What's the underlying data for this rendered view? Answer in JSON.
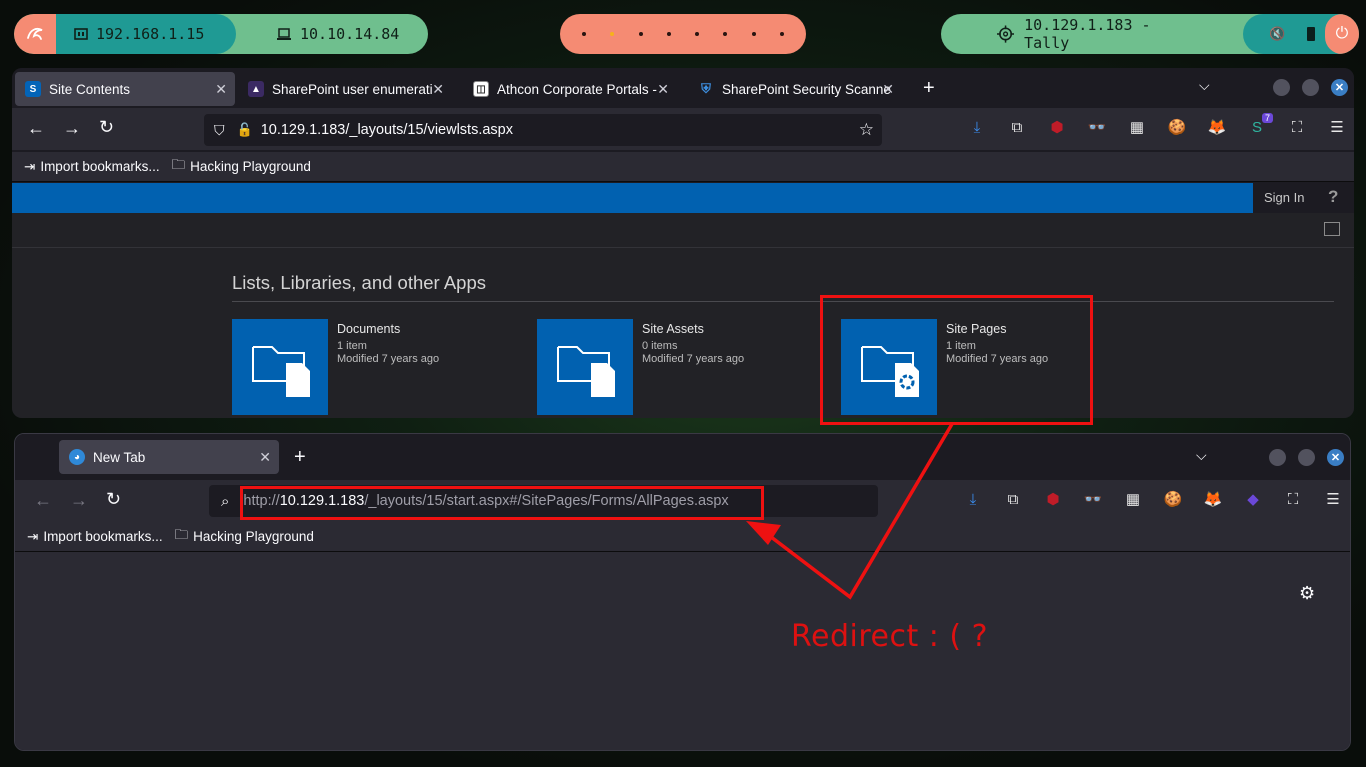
{
  "panel": {
    "local_ip": "192.168.1.15",
    "vpn_ip": "10.10.14.84",
    "target": "10.129.1.183 - Tally",
    "workspace_count": 8,
    "active_workspace": 2
  },
  "browser1": {
    "tabs": [
      {
        "label": "Site Contents",
        "icon": "sharepoint-icon",
        "active": true
      },
      {
        "label": "SharePoint user enumerati",
        "icon": "triangle-icon"
      },
      {
        "label": "Athcon Corporate Portals -",
        "icon": "page-icon"
      },
      {
        "label": "SharePoint Security Scanne",
        "icon": "shield-icon"
      }
    ],
    "url": "10.129.1.183/_layouts/15/viewlsts.aspx",
    "extension_badge": "7",
    "bookmarks": [
      "Import bookmarks...",
      "Hacking Playground"
    ]
  },
  "sharepoint": {
    "sign_in": "Sign In",
    "help": "?",
    "heading": "Lists, Libraries, and other Apps",
    "apps": [
      {
        "name": "Documents",
        "items": "1 item",
        "modified": "Modified 7 years ago"
      },
      {
        "name": "Site Assets",
        "items": "0 items",
        "modified": "Modified 7 years ago"
      },
      {
        "name": "Site Pages",
        "items": "1 item",
        "modified": "Modified 7 years ago"
      }
    ]
  },
  "browser2": {
    "tab": "New Tab",
    "url_prefix": "http://",
    "url_host": "10.129.1.183",
    "url_path": "/_layouts/15/start.aspx#/SitePages/Forms/AllPages.aspx",
    "bookmarks": [
      "Import bookmarks...",
      "Hacking Playground"
    ]
  },
  "annotation": {
    "text": "Redirect : ( ?",
    "color": "#ee1111"
  },
  "colors": {
    "sharepoint_blue": "#0161b0",
    "panel_green": "#6fbf8e",
    "panel_teal": "#1f9a94",
    "panel_salmon": "#f58b73"
  }
}
